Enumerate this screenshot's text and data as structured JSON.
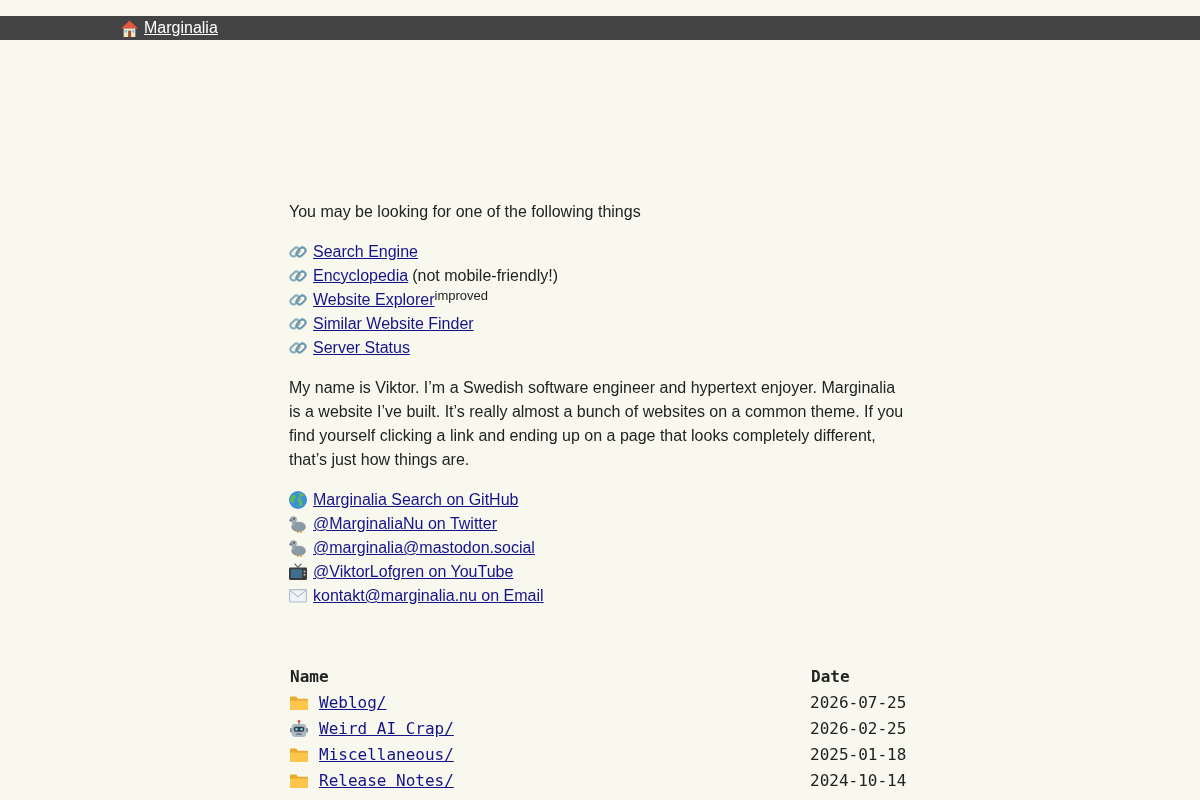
{
  "top_bar": {
    "home_link": "Marginalia"
  },
  "intro": "You may be looking for one of the following things",
  "links": [
    {
      "label": "Search Engine"
    },
    {
      "label": "Encyclopedia",
      "note": "(not mobile-friendly!)"
    },
    {
      "label": "Website Explorer",
      "superscript": "improved"
    },
    {
      "label": "Similar Website Finder"
    },
    {
      "label": "Server Status"
    }
  ],
  "about": "My name is Viktor. I’m a Swedish software engineer and hypertext enjoyer. Marginalia is a website I’ve built. It’s really almost a bunch of websites on a common theme. If you find yourself clicking a link and ending up on a page that looks completely different, that’s just how things are.",
  "contacts": [
    {
      "kind": "globe",
      "label": "Marginalia Search on GitHub"
    },
    {
      "kind": "bird",
      "label": "@MarginaliaNu on Twitter"
    },
    {
      "kind": "bird",
      "label": "@marginalia@mastodon.social"
    },
    {
      "kind": "tv",
      "label": "@ViktorLofgren on YouTube"
    },
    {
      "kind": "envelope",
      "label": "kontakt@marginalia.nu on Email"
    }
  ],
  "directory": {
    "columns": [
      "Name",
      "Date"
    ],
    "rows": [
      {
        "kind": "folder",
        "name": "Weblog/",
        "date": "2026-07-25"
      },
      {
        "kind": "robot",
        "name": "Weird AI Crap/",
        "date": "2026-02-25"
      },
      {
        "kind": "folder",
        "name": "Miscellaneous/",
        "date": "2025-01-18"
      },
      {
        "kind": "folder",
        "name": "Release Notes/",
        "date": "2024-10-14"
      }
    ]
  }
}
